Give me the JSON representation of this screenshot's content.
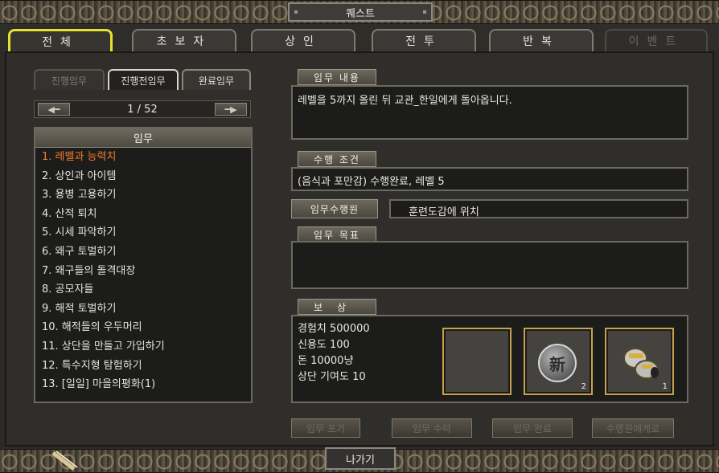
{
  "window": {
    "title": "퀘스트"
  },
  "tabs": [
    {
      "label": "전체",
      "state": "active"
    },
    {
      "label": "초보자",
      "state": "normal"
    },
    {
      "label": "상인",
      "state": "normal"
    },
    {
      "label": "전투",
      "state": "normal"
    },
    {
      "label": "반복",
      "state": "normal"
    },
    {
      "label": "이벤트",
      "state": "disabled"
    }
  ],
  "subtabs": [
    {
      "label": "진행임무",
      "state": "dim"
    },
    {
      "label": "진행전임무",
      "state": "active"
    },
    {
      "label": "완료임무",
      "state": "normal"
    }
  ],
  "pager": {
    "text": "1 / 52",
    "prev_icon": "left-arrow-icon",
    "next_icon": "right-arrow-icon"
  },
  "quest_list": {
    "header": "임무",
    "items": [
      "1. 레벨과 능력치",
      "2. 상인과 아이템",
      "3. 용병 고용하기",
      "4. 산적 퇴치",
      "5. 시세 파악하기",
      "6. 왜구 토벌하기",
      "7. 왜구들의 돌격대장",
      "8. 공모자들",
      "9. 해적 토벌하기",
      "10. 해적들의 우두머리",
      "11. 상단을 만들고 가입하기",
      "12. 특수지형 탐험하기",
      "13. [일일] 마을의평화(1)"
    ],
    "selected_index": 0
  },
  "details": {
    "content_label": "임무 내용",
    "content_text": "레벨을 5까지 올린 뒤 교관_한일에게 돌아옵니다.",
    "condition_label": "수행 조건",
    "condition_text": "(음식과 포만감) 수행완료, 레벨 5",
    "agent_label": "임무수행원",
    "agent_text": "훈련도감에 위치",
    "goal_label": "임무 목표",
    "goal_text": "",
    "reward_label": "보상",
    "rewards": [
      "경험치 500000",
      "신용도 100",
      "돈 10000냥",
      "상단 기여도 10"
    ],
    "slots": [
      {
        "icon": "empty-slot",
        "count": ""
      },
      {
        "icon": "new-coin-icon",
        "glyph": "新",
        "count": "2"
      },
      {
        "icon": "gauntlet-icon",
        "count": "1"
      }
    ]
  },
  "actions": {
    "abandon": "임무 포기",
    "accept": "임무 수락",
    "complete": "임무 완료",
    "to_agent": "수행원에게로"
  },
  "exit_label": "나가기",
  "colors": {
    "active_tab": "#e6e032",
    "selected_item": "#f27a2f",
    "slot_border": "#c9a14a"
  }
}
